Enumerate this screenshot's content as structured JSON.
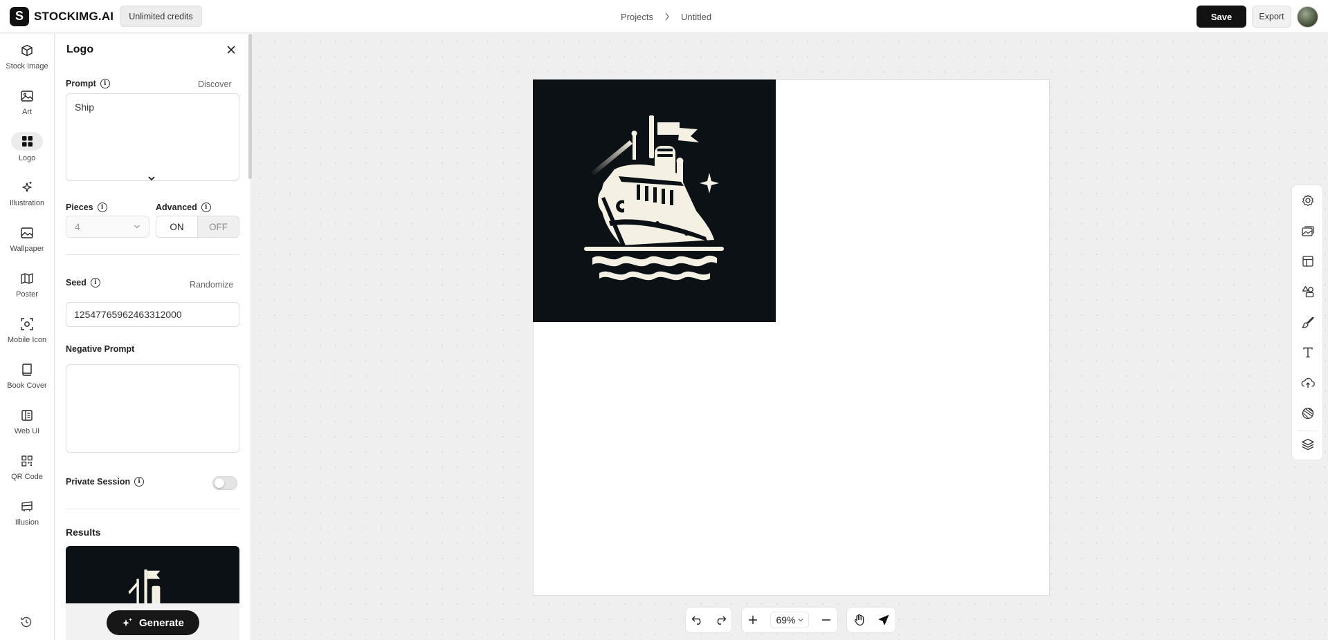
{
  "brand": {
    "name": "STOCKIMG.AI",
    "mark": "S",
    "credits": "Unlimited credits"
  },
  "breadcrumb": {
    "projects": "Projects",
    "current": "Untitled"
  },
  "actions": {
    "save": "Save",
    "export": "Export"
  },
  "rail": {
    "items": [
      {
        "label": "Stock Image",
        "icon": "cube-icon"
      },
      {
        "label": "Art",
        "icon": "image-icon"
      },
      {
        "label": "Logo",
        "icon": "grid-icon"
      },
      {
        "label": "Illustration",
        "icon": "sparkles-icon"
      },
      {
        "label": "Wallpaper",
        "icon": "wallpaper-icon"
      },
      {
        "label": "Poster",
        "icon": "map-icon"
      },
      {
        "label": "Mobile Icon",
        "icon": "focus-icon"
      },
      {
        "label": "Book Cover",
        "icon": "book-icon"
      },
      {
        "label": "Web UI",
        "icon": "layout-icon"
      },
      {
        "label": "QR Code",
        "icon": "qr-icon"
      },
      {
        "label": "Illusion",
        "icon": "illusion-icon"
      }
    ],
    "active": "Logo"
  },
  "panel": {
    "title": "Logo",
    "prompt_label": "Prompt",
    "discover": "Discover",
    "prompt_value": "Ship",
    "pieces_label": "Pieces",
    "pieces_value": "4",
    "advanced_label": "Advanced",
    "advanced_on": "ON",
    "advanced_off": "OFF",
    "seed_label": "Seed",
    "randomize": "Randomize",
    "seed_value": "12547765962463312000",
    "negative_label": "Negative Prompt",
    "negative_value": "",
    "private_label": "Private Session",
    "private_enabled": false,
    "results_label": "Results",
    "generate": "Generate"
  },
  "canvas": {
    "zoom": "69%",
    "colors": {
      "image_bg": "#0b1114",
      "ship": "#f4f0e4"
    }
  },
  "right_tools": [
    "settings-icon",
    "gallery-icon",
    "template-icon",
    "shapes-icon",
    "brush-icon",
    "text-icon",
    "upload-cloud-icon",
    "sticker-icon",
    "layers-icon"
  ]
}
